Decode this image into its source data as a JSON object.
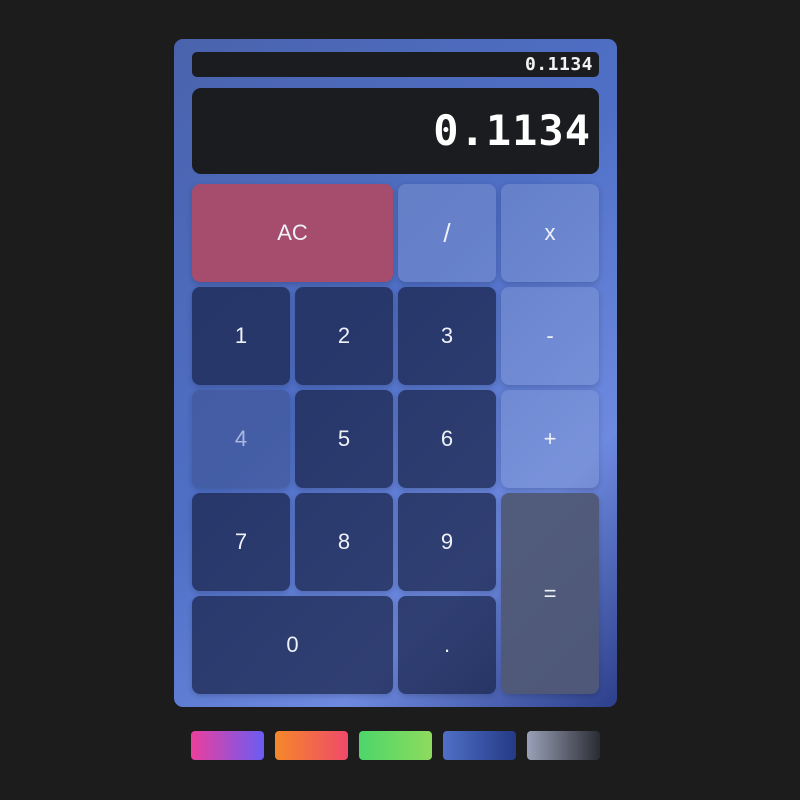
{
  "display": {
    "history": "0.1134",
    "value": "0.1134"
  },
  "keys": {
    "ac": "AC",
    "divide": "/",
    "multiply": "x",
    "one": "1",
    "two": "2",
    "three": "3",
    "minus": "-",
    "four": "4",
    "five": "5",
    "six": "6",
    "plus": "+",
    "seven": "7",
    "eight": "8",
    "nine": "9",
    "equals": "=",
    "zero": "0",
    "dot": "."
  },
  "themes": [
    {
      "name": "pink-purple",
      "colors": [
        "#ec3f9c",
        "#6a5cf4"
      ]
    },
    {
      "name": "orange-red",
      "colors": [
        "#f5882a",
        "#ef4a6a"
      ]
    },
    {
      "name": "green",
      "colors": [
        "#4cd66a",
        "#8edb5e"
      ]
    },
    {
      "name": "blue",
      "colors": [
        "#4f6fc6",
        "#243a85"
      ]
    },
    {
      "name": "gray",
      "colors": [
        "#9aa1b8",
        "#2a2c33"
      ]
    }
  ]
}
